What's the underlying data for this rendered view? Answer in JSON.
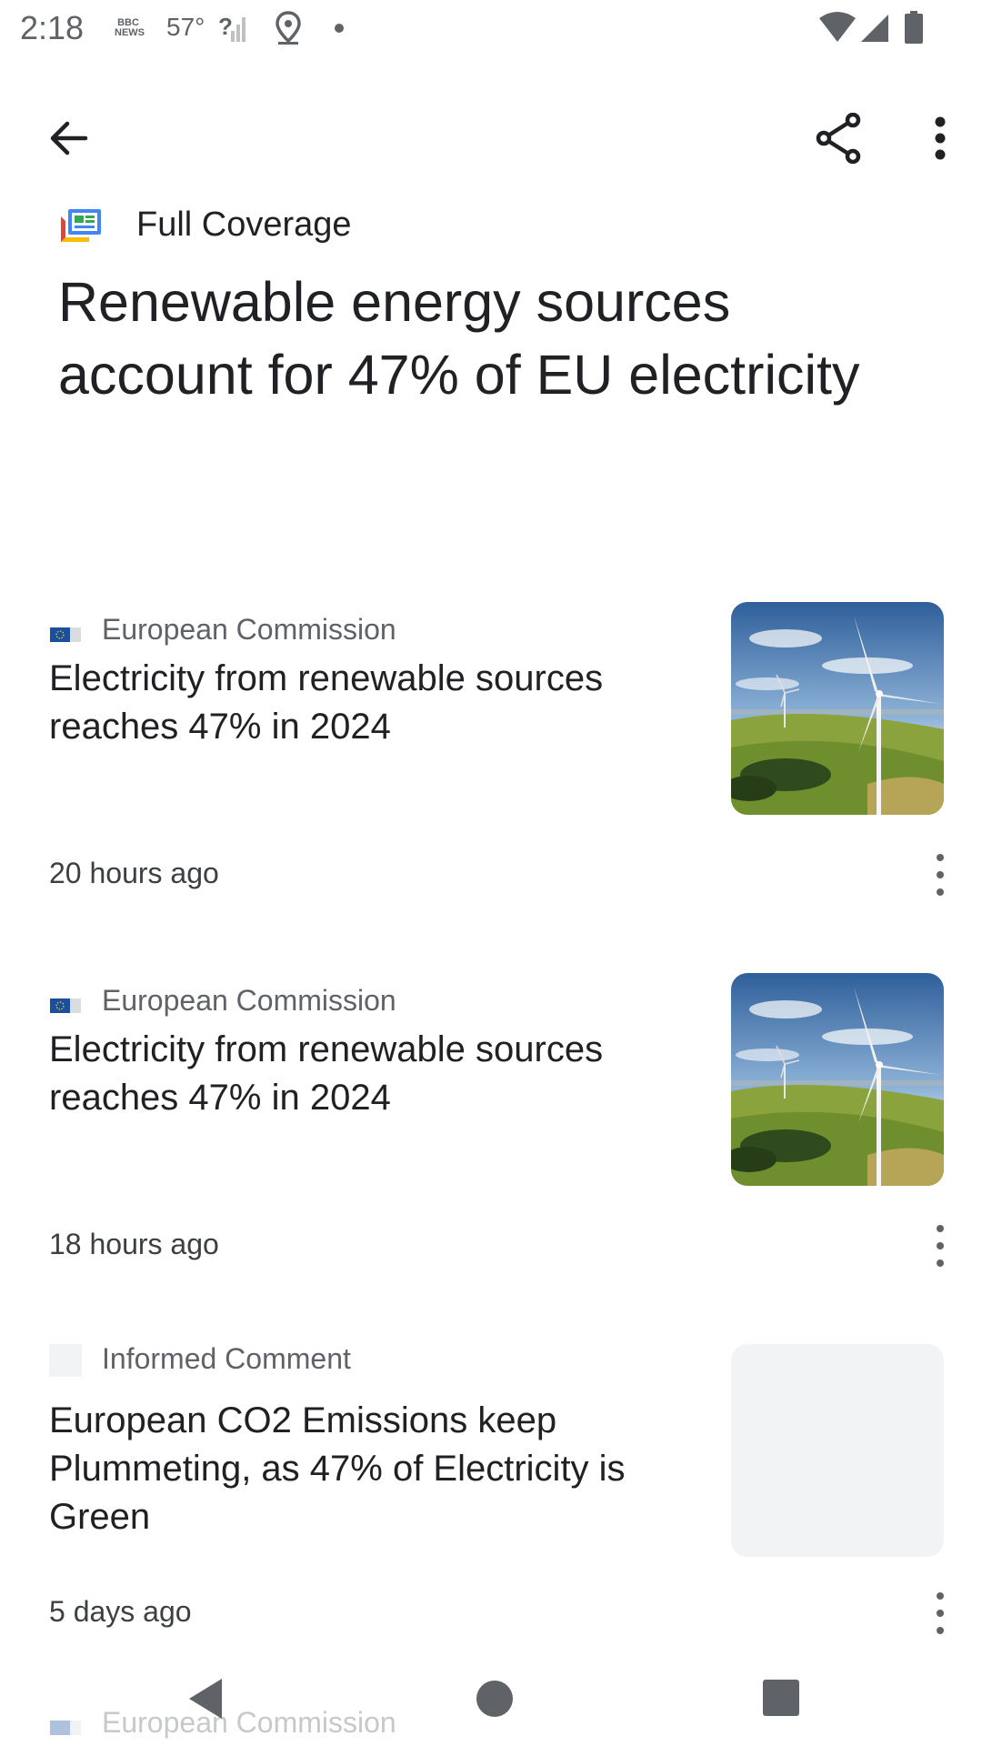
{
  "status_bar": {
    "time": "2:18",
    "news_label": "BBC NEWS",
    "temperature": "57°",
    "icons": [
      "bbc-news-icon",
      "no-signal-icon",
      "location-icon",
      "notification-dot-icon",
      "wifi-icon",
      "cell-signal-icon",
      "battery-icon"
    ]
  },
  "app_bar": {
    "icons": [
      "back-arrow-icon",
      "share-icon",
      "more-vert-icon"
    ]
  },
  "header": {
    "section_label": "Full Coverage",
    "section_icon": "full-coverage-icon",
    "headline": "Renewable energy sources account for 47% of EU electricity"
  },
  "articles": [
    {
      "source": "European Commission",
      "source_icon": "eu-flag-icon",
      "title": "Electricity from renewable sources reaches 47% in 2024",
      "time": "20 hours ago",
      "thumbnail": "wind-turbine-image"
    },
    {
      "source": "European Commission",
      "source_icon": "eu-flag-icon",
      "title": "Electricity from renewable sources reaches 47% in 2024",
      "time": "18 hours ago",
      "thumbnail": "wind-turbine-image"
    },
    {
      "source": "Informed Comment",
      "source_icon": "placeholder-icon",
      "title": "European CO2 Emissions keep Plummeting, as 47% of Electricity is Green",
      "time": "5 days ago",
      "thumbnail": "loading-placeholder"
    },
    {
      "source": "European Commission",
      "source_icon": "eu-flag-icon"
    }
  ],
  "nav_bar": {
    "icons": [
      "nav-back-icon",
      "nav-home-icon",
      "nav-recents-icon"
    ]
  },
  "colors": {
    "text_primary": "#202124",
    "text_secondary": "#5f6368",
    "placeholder": "#f1f3f4",
    "eu_blue": "#1a4fa0"
  }
}
